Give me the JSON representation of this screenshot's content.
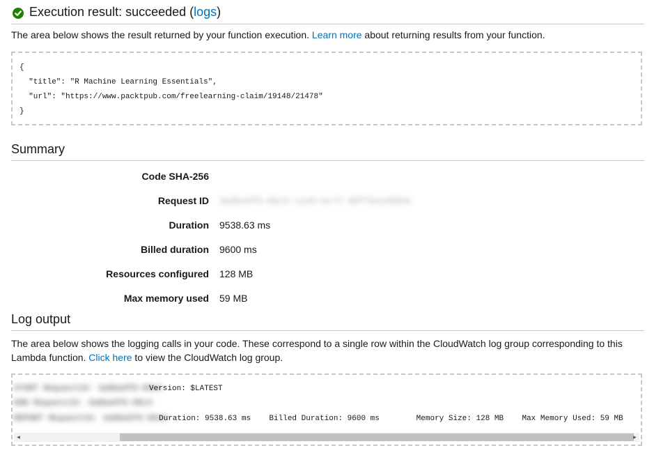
{
  "header": {
    "title_prefix": "Execution result: succeeded (",
    "logs_link": "logs",
    "title_suffix": ")",
    "status_color": "#1d8102"
  },
  "description": {
    "before_link": "The area below shows the result returned by your function execution. ",
    "link": "Learn more",
    "after_link": " about returning results from your function."
  },
  "result_json": {
    "lines": [
      "{",
      "  \"title\": \"R Machine Learning Essentials\",",
      "  \"url\": \"https://www.packtpub.com/freelearning-claim/19148/21478\"",
      "}"
    ]
  },
  "summary": {
    "heading": "Summary",
    "rows": [
      {
        "label": "Code SHA-256",
        "value": ""
      },
      {
        "label": "Request ID",
        "value": "3a8be0f0-08c5-11e8-9c7f-00ffbea40b9c"
      },
      {
        "label": "Duration",
        "value": "9538.63 ms"
      },
      {
        "label": "Billed duration",
        "value": "9600 ms"
      },
      {
        "label": "Resources configured",
        "value": "128 MB"
      },
      {
        "label": "Max memory used",
        "value": "59 MB"
      }
    ]
  },
  "log_output": {
    "heading": "Log output",
    "description_before": "The area below shows the logging calls in your code. These correspond to a single row within the CloudWatch log group corresponding to this Lambda function. ",
    "description_link": "Click here",
    "description_after": " to view the CloudWatch log group.",
    "lines": {
      "l1_hidden": "START RequestId: 3a8be0f0-08c5",
      "l1_visible": "Version: $LATEST",
      "l2_hidden": "END RequestId: 3a8be0f0-08c5",
      "l3_hidden": "REPORT RequestId: 3a8be0f0-08c5",
      "l3_visible": "Duration: 9538.63 ms    Billed Duration: 9600 ms        Memory Size: 128 MB    Max Memory Used: 59 MB"
    }
  },
  "scroll": {
    "left_arrow": "◂",
    "right_arrow": "▸"
  }
}
